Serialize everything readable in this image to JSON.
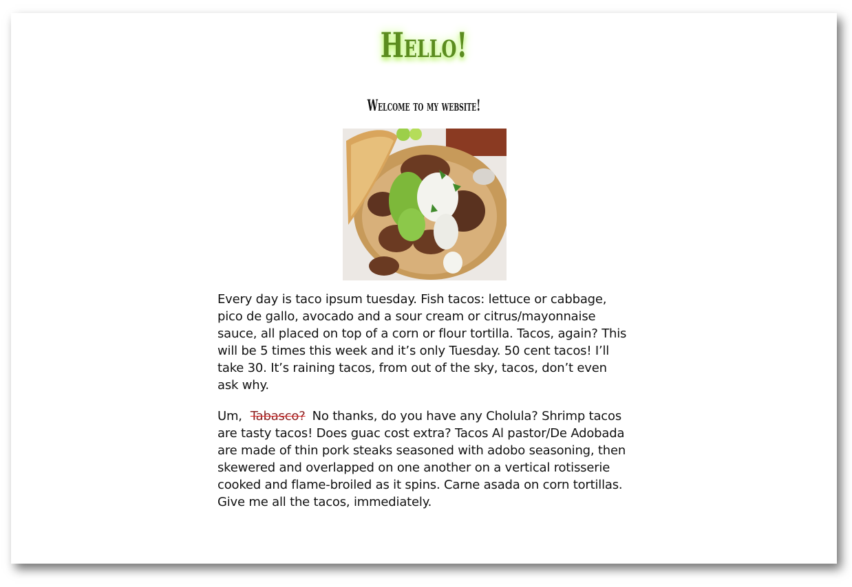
{
  "header": {
    "title": "Hello!",
    "subtitle": "Welcome to my website!"
  },
  "image": {
    "icon": "taco-photo"
  },
  "content": {
    "paragraph1": "Every day is taco ipsum tuesday. Fish tacos: lettuce or cabbage, pico de gallo, avocado and a sour cream or citrus/mayonnaise sauce, all placed on top of a corn or flour tortilla. Tacos, again? This will be 5 times this week and it’s only Tuesday. 50 cent tacos! I’ll take 30. It’s raining tacos, from out of the sky, tacos, don’t even ask why.",
    "paragraph2_start": "Um,",
    "paragraph2_struck": "Tabasco?",
    "paragraph2_rest": "No thanks, do you have any Cholula? Shrimp tacos are tasty tacos! Does guac cost extra? Tacos Al pastor/De Adobada are made of thin pork steaks seasoned with adobo seasoning, then skewered and overlapped on one another on a vertical rotisserie cooked and flame-broiled as it spins. Carne asada on corn tortillas. Give me all the tacos, immediately."
  },
  "colors": {
    "title": "#5b8c1f",
    "title_glow": "#b8f06a",
    "strike": "#d22222"
  }
}
